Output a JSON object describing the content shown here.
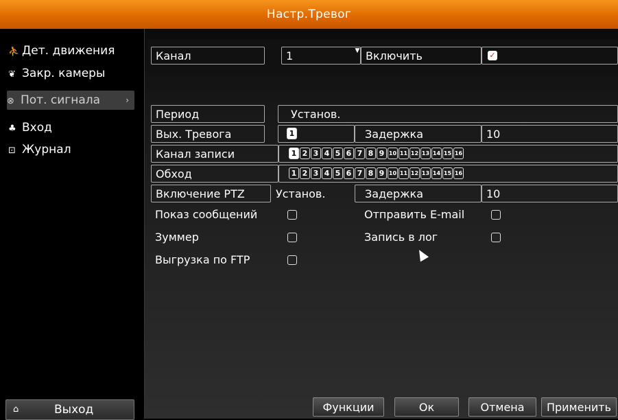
{
  "window": {
    "title": "Настр.Тревог"
  },
  "sidebar": {
    "items": [
      {
        "label": "Дет. движения",
        "icon": "motion-icon"
      },
      {
        "label": "Закр. камеры",
        "icon": "tamper-icon"
      },
      {
        "label": "Пот. сигнала",
        "icon": "video-loss-icon",
        "active": true
      },
      {
        "label": "Вход",
        "icon": "input-icon"
      },
      {
        "label": "Журнал",
        "icon": "log-icon"
      }
    ],
    "exit_label": "Выход"
  },
  "form": {
    "channel_label": "Канал",
    "channel_value": "1",
    "enable_label": "Включить",
    "enable_checked": true,
    "period_label": "Период",
    "period_value": "Установ.",
    "alarm_out_label": "Вых. Тревога",
    "alarm_out_value": "1",
    "delay_label": "Задержка",
    "delay_value": "10",
    "record_channel_label": "Канал записи",
    "record_channels": [
      "1",
      "2",
      "3",
      "4",
      "5",
      "6",
      "7",
      "8",
      "9",
      "10",
      "11",
      "12",
      "13",
      "14",
      "15",
      "16"
    ],
    "record_channels_selected": [
      "1"
    ],
    "tour_label": "Обход",
    "tour_channels": [
      "1",
      "2",
      "3",
      "4",
      "5",
      "6",
      "7",
      "8",
      "9",
      "10",
      "11",
      "12",
      "13",
      "14",
      "15",
      "16"
    ],
    "ptz_label": "Включение PTZ",
    "ptz_value": "Установ.",
    "ptz_delay_label": "Задержка",
    "ptz_delay_value": "10",
    "show_message_label": "Показ сообщений",
    "send_email_label": "Отправить E-mail",
    "buzzer_label": "Зуммер",
    "write_log_label": "Запись в лог",
    "ftp_upload_label": "Выгрузка по FTP"
  },
  "buttons": {
    "functions": "Функции",
    "ok": "Ок",
    "cancel": "Отмена",
    "apply": "Применить"
  },
  "colors": {
    "title_bar": "#e87a10",
    "background": "#000000",
    "active_item": "#3d3d3d"
  }
}
